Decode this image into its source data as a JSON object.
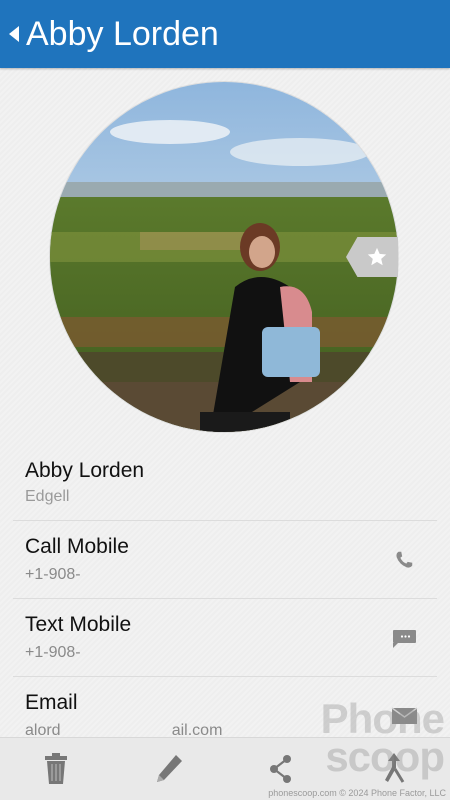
{
  "header": {
    "title": "Abby Lorden",
    "back_icon": "chevron-left-icon",
    "background_color": "#1f74bd"
  },
  "photo": {
    "favorite_icon": "star-icon"
  },
  "contact": {
    "name": "Abby Lorden",
    "company": "Edgell"
  },
  "actions": [
    {
      "label": "Call Mobile",
      "value": "+1-908-",
      "icon": "phone-icon"
    },
    {
      "label": "Text Mobile",
      "value": "+1-908-",
      "icon": "message-icon"
    },
    {
      "label": "Email",
      "value": "alord                         ail.com",
      "icon": "mail-icon"
    }
  ],
  "bottom_bar": {
    "buttons": [
      "trash-icon",
      "edit-icon",
      "share-icon",
      "merge-icon"
    ]
  },
  "watermark": {
    "brand": "Phone scoop",
    "site": "phonescoop.com",
    "copyright": "© 2024 Phone Factor, LLC"
  }
}
